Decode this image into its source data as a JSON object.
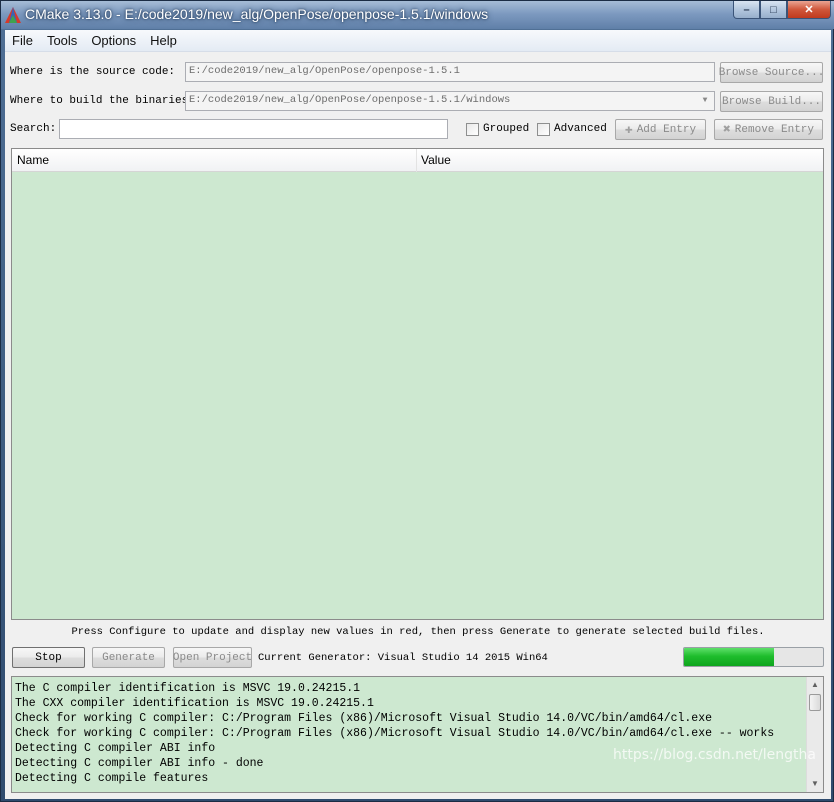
{
  "window": {
    "title": "CMake 3.13.0 - E:/code2019/new_alg/OpenPose/openpose-1.5.1/windows",
    "minimize_glyph": "–",
    "maximize_glyph": "□",
    "close_glyph": "✕"
  },
  "menu": [
    "File",
    "Tools",
    "Options",
    "Help"
  ],
  "source": {
    "label": "Where is the source code:",
    "value": "E:/code2019/new_alg/OpenPose/openpose-1.5.1",
    "button": "Browse Source..."
  },
  "build": {
    "label": "Where to build the binaries:",
    "value": "E:/code2019/new_alg/OpenPose/openpose-1.5.1/windows",
    "button": "Browse Build..."
  },
  "search": {
    "label": "Search:",
    "value": "",
    "grouped_label": "Grouped",
    "grouped_checked": false,
    "advanced_label": "Advanced",
    "advanced_checked": false,
    "add_entry": "Add Entry",
    "remove_entry": "Remove Entry"
  },
  "table": {
    "columns": [
      "Name",
      "Value"
    ],
    "rows": []
  },
  "hint": "Press Configure to update and display new values in red, then press Generate to generate selected build files.",
  "actions": {
    "stop": "Stop",
    "generate": "Generate",
    "open_project": "Open Project",
    "generator": "Current Generator: Visual Studio 14 2015 Win64"
  },
  "progress": {
    "fraction": 0.65
  },
  "output": [
    "The C compiler identification is MSVC 19.0.24215.1",
    "The CXX compiler identification is MSVC 19.0.24215.1",
    "Check for working C compiler: C:/Program Files (x86)/Microsoft Visual Studio 14.0/VC/bin/amd64/cl.exe",
    "Check for working C compiler: C:/Program Files (x86)/Microsoft Visual Studio 14.0/VC/bin/amd64/cl.exe -- works",
    "Detecting C compiler ABI info",
    "Detecting C compiler ABI info - done",
    "Detecting C compile features"
  ],
  "watermark": "https://blog.csdn.net/lengtha",
  "colors": {
    "table_bg": "#cde8d0",
    "progress": "#1fbd2d"
  }
}
